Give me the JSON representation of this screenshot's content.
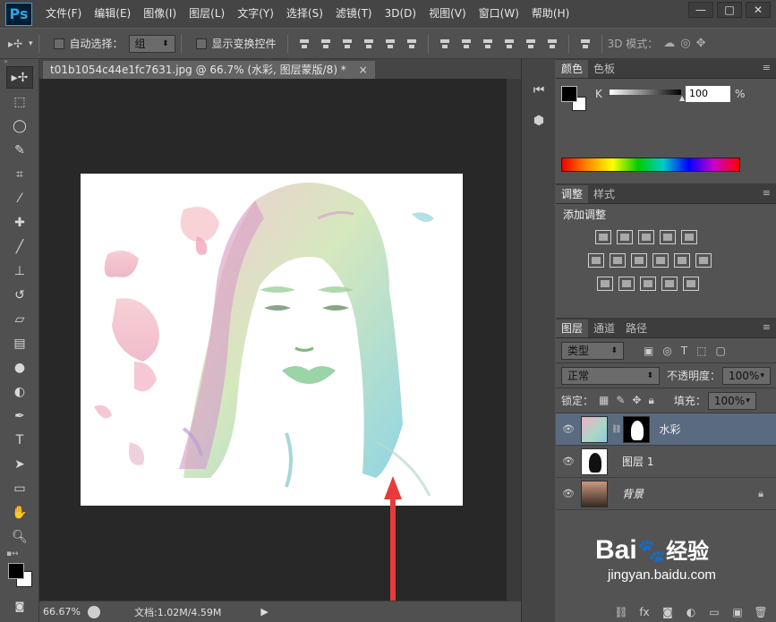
{
  "menubar": {
    "logo": "Ps",
    "items": [
      "文件(F)",
      "编辑(E)",
      "图像(I)",
      "图层(L)",
      "文字(Y)",
      "选择(S)",
      "滤镜(T)",
      "3D(D)",
      "视图(V)",
      "窗口(W)",
      "帮助(H)"
    ],
    "window_controls": [
      "—",
      "□",
      "✕"
    ]
  },
  "optionsbar": {
    "auto_select_label": "自动选择：",
    "auto_select_value": "组",
    "show_transform_label": "显示变换控件",
    "mode_3d_label": "3D 模式："
  },
  "document": {
    "tab_title": "t01b1054c44e1fc7631.jpg @ 66.7% (水彩, 图层蒙版/8) *",
    "close": "×"
  },
  "status": {
    "zoom": "66.67%",
    "doc_info": "文档:1.02M/4.59M"
  },
  "color_panel": {
    "tabs": [
      "颜色",
      "色板"
    ],
    "channel_label": "K",
    "channel_value": "100",
    "percent": "%"
  },
  "adjustments_panel": {
    "tabs": [
      "调整",
      "样式"
    ],
    "heading": "添加调整"
  },
  "layers_panel": {
    "tabs": [
      "图层",
      "通道",
      "路径"
    ],
    "filter_type": "类型",
    "blend_mode": "正常",
    "opacity_label": "不透明度：",
    "opacity_value": "100%",
    "lock_label": "锁定：",
    "fill_label": "填充：",
    "fill_value": "100%",
    "layers": [
      {
        "name": "水彩",
        "selected": true
      },
      {
        "name": "图层 1",
        "selected": false
      },
      {
        "name": "背景",
        "selected": false
      }
    ]
  },
  "watermark": {
    "brand": "Bai",
    "brand_cn": "经验",
    "url": "jingyan.baidu.com"
  }
}
